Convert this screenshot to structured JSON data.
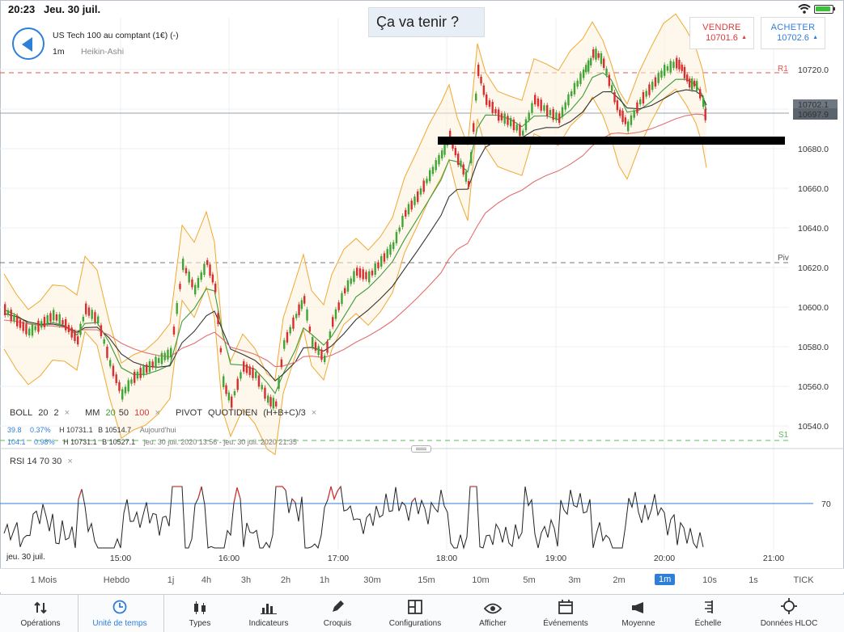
{
  "status_bar": {
    "time": "20:23",
    "date": "Jeu. 30 juil."
  },
  "caption": "Ça va tenir ?",
  "header": {
    "instrument": "US Tech 100 au comptant (1€) (-)",
    "timeframe": "1m",
    "chart_type": "Heikin-Ashi"
  },
  "quotes": {
    "sell_label": "VENDRE",
    "sell_price": "10701.6",
    "sell_arrow": "▲",
    "buy_label": "ACHETER",
    "buy_price": "10702.6",
    "buy_arrow": "▲"
  },
  "y_axis": {
    "ticks": [
      "10720.0",
      "10700.0",
      "10680.0",
      "10660.0",
      "10640.0",
      "10620.0",
      "10600.0",
      "10580.0",
      "10560.0",
      "10540.0"
    ],
    "current_price_label": "10697.9",
    "hidden_price_label": "10702.1"
  },
  "levels": {
    "r1": "R1",
    "piv": "Piv",
    "s1": "S1"
  },
  "legend": {
    "boll_name": "BOLL",
    "boll_p1": "20",
    "boll_p2": "2",
    "mm_name": "MM",
    "mm_p1": "20",
    "mm_p2": "50",
    "mm_p3": "100",
    "pivot_name": "PIVOT",
    "pivot_p1": "QUOTIDIEN",
    "pivot_p2": "(H+B+C)/3",
    "close_symbol": "×",
    "row2_a": "39.8",
    "row2_b": "0.37%",
    "row2_h": "H 10731.1",
    "row2_l": "B 10514.7",
    "row2_c": "Aujourd'hui",
    "row3_a": "104.1",
    "row3_b": "0.98%",
    "row3_h": "H 10731.1",
    "row3_l": "B 10527.1",
    "row3_c": "jeu. 30 juil. 2020 13:56 - jeu. 30 juil. 2020 21:35"
  },
  "rsi": {
    "name": "RSI",
    "p1": "14",
    "p2": "70",
    "p3": "30",
    "level_label": "70"
  },
  "x_axis": {
    "date_label": "jeu. 30 juil.",
    "ticks": [
      "15:00",
      "16:00",
      "17:00",
      "18:00",
      "19:00",
      "20:00",
      "21:00"
    ]
  },
  "timeframes": [
    "1 Mois",
    "Hebdo",
    "1j",
    "4h",
    "3h",
    "2h",
    "1h",
    "30m",
    "15m",
    "10m",
    "5m",
    "3m",
    "2m",
    "1m",
    "10s",
    "1s",
    "TICK"
  ],
  "active_timeframe": "1m",
  "toolbar": [
    {
      "label": "Opérations",
      "icon": "swap-arrows-icon"
    },
    {
      "label": "Unité de temps",
      "icon": "clock-icon"
    },
    {
      "label": "Types",
      "icon": "candles-icon"
    },
    {
      "label": "Indicateurs",
      "icon": "bar-chart-icon"
    },
    {
      "label": "Croquis",
      "icon": "pencil-icon"
    },
    {
      "label": "Configurations",
      "icon": "layout-icon"
    },
    {
      "label": "Afficher",
      "icon": "eye-icon"
    },
    {
      "label": "Événements",
      "icon": "calendar-icon"
    },
    {
      "label": "Moyenne",
      "icon": "megaphone-icon"
    },
    {
      "label": "Échelle",
      "icon": "scale-icon"
    },
    {
      "label": "Données HLOC",
      "icon": "crosshair-icon"
    }
  ],
  "colors": {
    "accent": "#2f7ed8",
    "sell": "#d93a3a",
    "bull_candle": "#3fa535",
    "bear_candle": "#d62f2f",
    "bollinger": "#f0a830",
    "ma20": "#3b9b3b",
    "ma50": "#333333",
    "ma100": "#e07070",
    "support_line": "#000000"
  }
}
